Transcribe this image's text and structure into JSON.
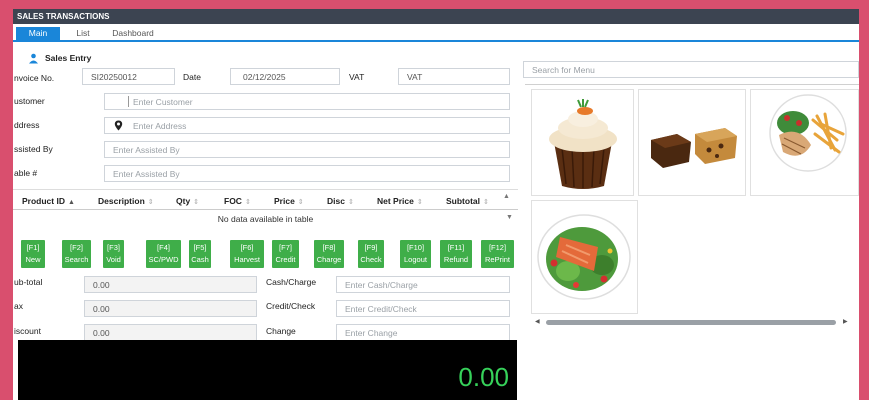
{
  "window": {
    "title": "SALES TRANSACTIONS"
  },
  "tabs": [
    {
      "label": "Main",
      "active": true
    },
    {
      "label": "List",
      "active": false
    },
    {
      "label": "Dashboard",
      "active": false
    }
  ],
  "section": {
    "title": "Sales Entry"
  },
  "form": {
    "invoice_label": "nvoice No.",
    "invoice_value": "SI20250012",
    "date_label": "Date",
    "date_value": "02/12/2025",
    "vat_label": "VAT",
    "vat_value": "VAT",
    "customer_label": "ustomer",
    "customer_placeholder": "Enter Customer",
    "address_label": "ddress",
    "address_placeholder": "Enter Address",
    "assisted_label": "ssisted By",
    "assisted_placeholder": "Enter Assisted By",
    "table_label": "able #",
    "table_placeholder": "Enter Assisted By"
  },
  "grid": {
    "columns": [
      "Product ID",
      "Description",
      "Qty",
      "FOC",
      "Price",
      "Disc",
      "Net Price",
      "Subtotal"
    ],
    "empty_text": "No data available in table"
  },
  "fkeys": [
    {
      "key": "[F1]",
      "label": "New"
    },
    {
      "key": "[F2]",
      "label": "Search"
    },
    {
      "key": "[F3]",
      "label": "Void"
    },
    {
      "key": "[F4]",
      "label": "SC/PWD"
    },
    {
      "key": "[F5]",
      "label": "Cash"
    },
    {
      "key": "[F6]",
      "label": "Harvest"
    },
    {
      "key": "[F7]",
      "label": "Credit"
    },
    {
      "key": "[F8]",
      "label": "Charge"
    },
    {
      "key": "[F9]",
      "label": "Check"
    },
    {
      "key": "[F10]",
      "label": "Logout"
    },
    {
      "key": "[F11]",
      "label": "Refund"
    },
    {
      "key": "[F12]",
      "label": "RePrint"
    }
  ],
  "totals": {
    "subtotal_label": "ub-total",
    "subtotal_value": "0.00",
    "tax_label": "ax",
    "tax_value": "0.00",
    "discount_label": "iscount",
    "discount_value": "0.00",
    "cash_label": "Cash/Charge",
    "cash_placeholder": "Enter Cash/Charge",
    "credit_label": "Credit/Check",
    "credit_placeholder": "Enter Credit/Check",
    "change_label": "Change",
    "change_placeholder": "Enter Change"
  },
  "display": {
    "amount": "0.00"
  },
  "menu": {
    "search_placeholder": "Search for Menu",
    "items": [
      "cupcake-image",
      "brownies-image",
      "grilled-chicken-fries-image",
      "salmon-salad-image"
    ]
  },
  "colors": {
    "accent": "#1a86d9",
    "fkey": "#3fae49",
    "titlebar": "#3c4451",
    "display_text": "#36d15a",
    "border": "#d94f6e"
  }
}
